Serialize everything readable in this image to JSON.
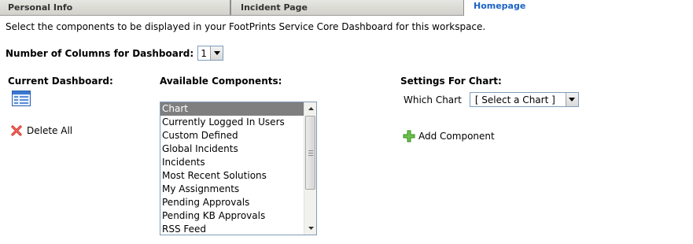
{
  "tabs": [
    {
      "label": "Personal Info"
    },
    {
      "label": "Incident Page"
    },
    {
      "label": "Homepage"
    }
  ],
  "intro_text": "Select the components to be displayed in your FootPrints Service Core Dashboard for this workspace.",
  "columns": {
    "label": "Number of Columns for Dashboard:",
    "value": "1"
  },
  "current_dashboard": {
    "title": "Current Dashboard:",
    "delete_all_label": "Delete All"
  },
  "available_components": {
    "title": "Available Components:",
    "items": [
      "Chart",
      "Currently Logged In Users",
      "Custom Defined",
      "Global Incidents",
      "Incidents",
      "Most Recent Solutions",
      "My Assignments",
      "Pending Approvals",
      "Pending KB Approvals",
      "RSS Feed"
    ],
    "selected": "Chart"
  },
  "settings": {
    "title": "Settings For Chart:",
    "which_chart_label": "Which Chart",
    "which_chart_value": "[ Select a Chart ]",
    "add_component_label": "Add Component"
  },
  "colors": {
    "active_tab": "#1a63c4",
    "selected_item_bg": "#7f7f7f",
    "delete_icon": "#d9342b",
    "add_icon": "#4caf32"
  }
}
